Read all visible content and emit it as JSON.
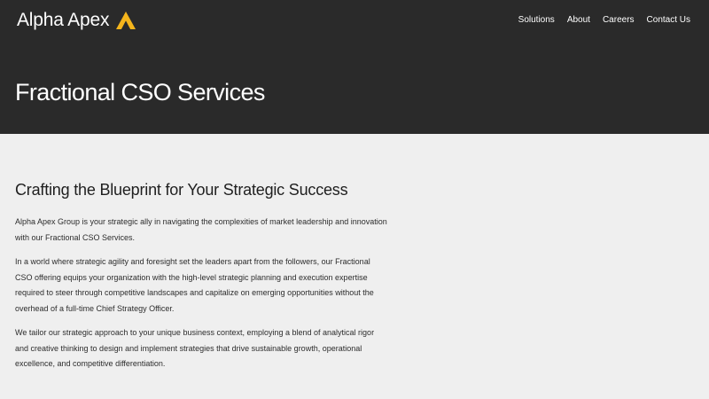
{
  "header": {
    "brand_name": "Alpha Apex",
    "logo_icon": "triangle-a-logo-icon",
    "logo_color": "#f5b51c",
    "nav": [
      {
        "label": "Solutions"
      },
      {
        "label": "About"
      },
      {
        "label": "Careers"
      },
      {
        "label": "Contact Us"
      }
    ],
    "page_title": "Fractional CSO Services",
    "background": "#2a2a2a"
  },
  "main": {
    "heading": "Crafting the Blueprint for Your Strategic Success",
    "paragraphs": [
      "Alpha Apex Group is your strategic ally in navigating the complexities of market leadership and innovation with our Fractional CSO Services.",
      "In a world where strategic agility and foresight set the leaders apart from the followers, our Fractional CSO offering equips your organization with the high-level strategic planning and execution expertise required to steer through competitive landscapes and capitalize on emerging opportunities without the overhead of a full-time Chief Strategy Officer.",
      "We tailor our strategic approach to your unique business context, employing a blend of analytical rigor and creative thinking to design and implement strategies that drive sustainable growth, operational excellence, and competitive differentiation."
    ],
    "background": "#efefef"
  }
}
